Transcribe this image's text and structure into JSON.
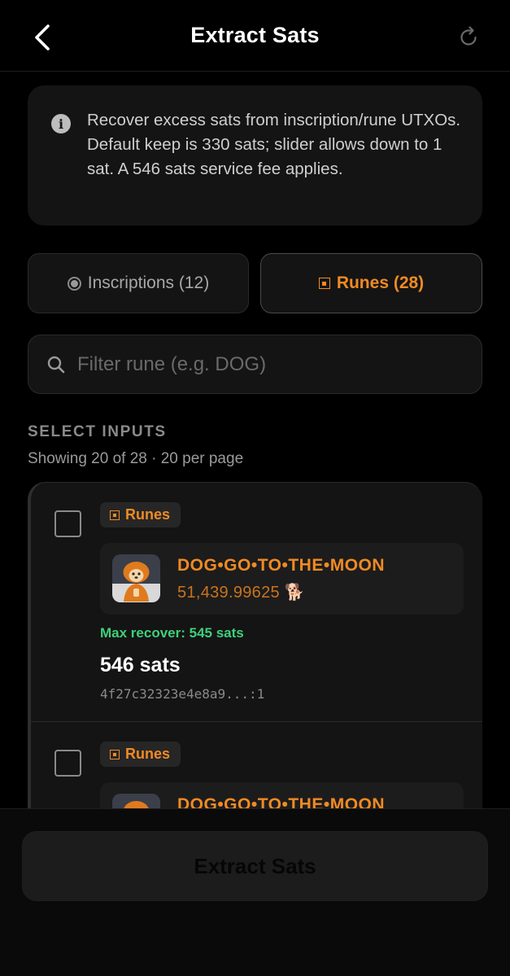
{
  "header": {
    "title": "Extract Sats"
  },
  "info": {
    "text": "Recover excess sats from inscription/rune UTXOs. Default keep is 330 sats; slider allows down to 1 sat. A 546 sats service fee applies."
  },
  "tabs": [
    {
      "label": "Inscriptions (12)",
      "active": false,
      "icon": "radio-icon"
    },
    {
      "label": "Runes (28)",
      "active": true,
      "icon": "rune-icon"
    }
  ],
  "search": {
    "placeholder": "Filter rune (e.g. DOG)",
    "value": ""
  },
  "section": {
    "title": "SELECT INPUTS",
    "subtitle": "Showing 20 of 28 · 20 per page"
  },
  "inputs": [
    {
      "badge": "Runes",
      "name": "DOG•GO•TO•THE•MOON",
      "amount": "51,439.99625 🐕",
      "max_recover": "Max recover: 545 sats",
      "sats": "546 sats",
      "txid": "4f27c32323e4e8a9...:1",
      "checked": false
    },
    {
      "badge": "Runes",
      "name": "DOG•GO•TO•THE•MOON",
      "checked": false
    }
  ],
  "footer": {
    "button_label": "Extract Sats"
  },
  "colors": {
    "accent": "#f08a24",
    "success": "#3dd07a",
    "background": "#000000",
    "card": "#141414"
  }
}
